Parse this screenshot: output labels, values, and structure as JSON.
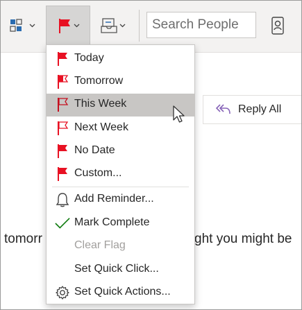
{
  "toolbar": {
    "categorize_icon": "categorize-icon",
    "flag_icon": "flag-icon",
    "move_icon": "move-to-folder-icon",
    "search_placeholder": "Search People",
    "address_book_icon": "address-book-icon"
  },
  "reply_all": {
    "label": "Reply All",
    "icon": "reply-all-icon"
  },
  "message_body": {
    "left_text": "tomorr",
    "right_text": "ght you might be"
  },
  "menu": {
    "items": [
      {
        "label": "Today",
        "icon": "red-flag-icon"
      },
      {
        "label": "Tomorrow",
        "icon": "red-flag-icon"
      },
      {
        "label": "This Week",
        "icon": "red-flag-icon",
        "highlighted": true
      },
      {
        "label": "Next Week",
        "icon": "red-flag-icon"
      },
      {
        "label": "No Date",
        "icon": "red-flag-icon"
      },
      {
        "label": "Custom...",
        "icon": "red-flag-icon"
      },
      {
        "label": "Add Reminder...",
        "icon": "bell-icon"
      },
      {
        "label": "Mark Complete",
        "icon": "checkmark-icon"
      },
      {
        "label": "Clear Flag",
        "icon": "",
        "disabled": true
      },
      {
        "label": "Set Quick Click...",
        "icon": ""
      },
      {
        "label": "Set Quick Actions...",
        "icon": "gear-icon"
      }
    ]
  },
  "colors": {
    "flag_red": "#e81123",
    "check_green": "#107c10",
    "reply_purple": "#8764b8",
    "accent_blue": "#2b6cb0",
    "highlight": "#c8c6c4"
  }
}
